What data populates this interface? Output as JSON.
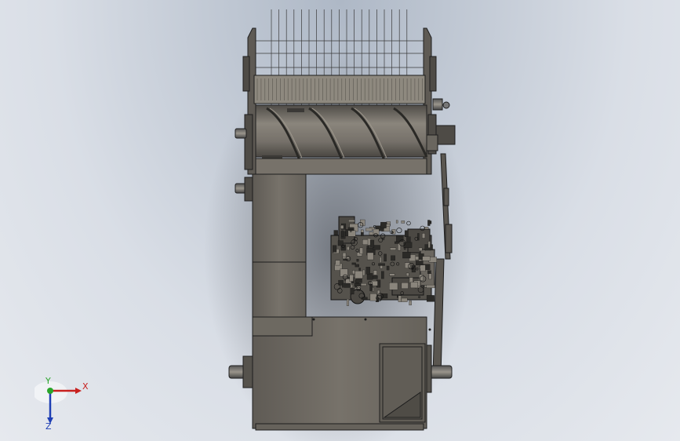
{
  "viewport": {
    "background_top": "#aeb8c6",
    "background_bottom": "#e6e9ee",
    "model_body_color": "#6e6a62",
    "model_edge_color": "#1e1e1e"
  },
  "triad": {
    "x_label": "X",
    "y_label": "Y",
    "z_label": "Z",
    "x_color": "#c8201e",
    "y_color": "#2aa52a",
    "z_color": "#1f3fb4"
  }
}
